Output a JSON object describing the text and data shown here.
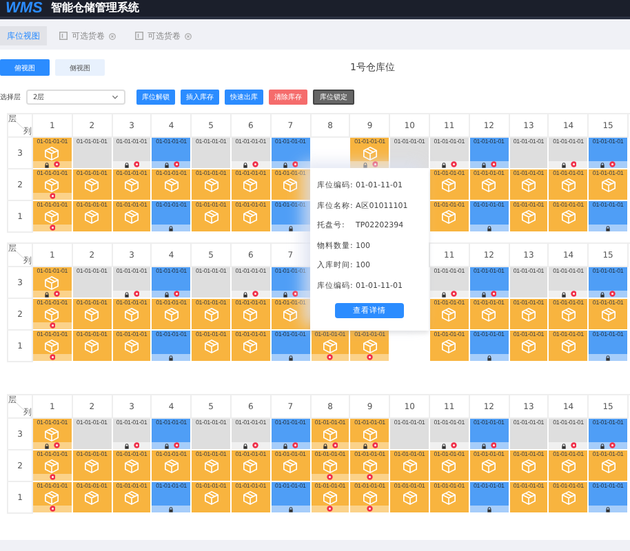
{
  "header": {
    "logo": "WMS",
    "title": "智能仓储管理系统"
  },
  "tabs": [
    {
      "label": "库位视图",
      "selected": true,
      "closable": false
    },
    {
      "label": "可选货卷",
      "selected": false,
      "closable": true
    },
    {
      "label": "可选货卷",
      "selected": false,
      "closable": true
    }
  ],
  "views": [
    {
      "label": "俯视图",
      "selected": true
    },
    {
      "label": "侧视图",
      "selected": false
    }
  ],
  "page_title": "1号仓库位",
  "layer_select": {
    "label": "选择层",
    "value": "2层"
  },
  "actions": [
    {
      "label": "库位解锁",
      "kind": "primary"
    },
    {
      "label": "插入库存",
      "kind": "primary"
    },
    {
      "label": "快速出库",
      "kind": "primary"
    },
    {
      "label": "清除库存",
      "kind": "danger"
    },
    {
      "label": "库位锁定",
      "kind": "dark"
    }
  ],
  "grids": [
    {
      "corner": {
        "top": "层",
        "bottom": "列"
      },
      "columns": [
        "1",
        "2",
        "3",
        "4",
        "5",
        "6",
        "7",
        "8",
        "9",
        "10",
        "11",
        "12",
        "13",
        "14",
        "15"
      ],
      "rows": [
        {
          "label": "3",
          "cells": [
            {
              "kind": "stocked",
              "code": "01-01-01-01",
              "locked": true,
              "alert": true
            },
            {
              "kind": "empty",
              "code": "01-01-01-01",
              "locked": false,
              "alert": false
            },
            {
              "kind": "empty",
              "code": "01-01-01-01",
              "locked": true,
              "alert": true
            },
            {
              "kind": "frozen",
              "code": "01-01-01-01",
              "locked": true,
              "alert": true
            },
            {
              "kind": "empty",
              "code": "01-01-01-01",
              "locked": false,
              "alert": false
            },
            {
              "kind": "empty",
              "code": "01-01-01-01",
              "locked": true,
              "alert": true
            },
            {
              "kind": "frozen",
              "code": "01-01-01-01",
              "locked": true,
              "alert": true
            },
            null,
            {
              "kind": "stocked",
              "code": "01-01-01-01",
              "locked": true,
              "alert": true
            },
            {
              "kind": "empty",
              "code": "01-01-01-01",
              "locked": false,
              "alert": false
            },
            {
              "kind": "empty",
              "code": "01-01-01-01",
              "locked": true,
              "alert": true
            },
            {
              "kind": "frozen",
              "code": "01-01-01-01",
              "locked": true,
              "alert": true
            },
            {
              "kind": "empty",
              "code": "01-01-01-01",
              "locked": false,
              "alert": false
            },
            {
              "kind": "empty",
              "code": "01-01-01-01",
              "locked": true,
              "alert": true
            },
            {
              "kind": "frozen",
              "code": "01-01-01-01",
              "locked": true,
              "alert": true
            }
          ]
        },
        {
          "label": "2",
          "cells": [
            {
              "kind": "stocked",
              "code": "01-01-01-01",
              "locked": false,
              "alert": true
            },
            {
              "kind": "stocked",
              "code": "01-01-01-01",
              "locked": false,
              "alert": false
            },
            {
              "kind": "stocked",
              "code": "01-01-01-01",
              "locked": false,
              "alert": false
            },
            {
              "kind": "stocked",
              "code": "01-01-01-01",
              "locked": false,
              "alert": false
            },
            {
              "kind": "stocked",
              "code": "01-01-01-01",
              "locked": false,
              "alert": false
            },
            {
              "kind": "stocked",
              "code": "01-01-01-01",
              "locked": false,
              "alert": false
            },
            {
              "kind": "stocked",
              "code": "01-01-01-01",
              "locked": false,
              "alert": false
            },
            null,
            null,
            null,
            {
              "kind": "stocked",
              "code": "01-01-01-01",
              "locked": false,
              "alert": false
            },
            {
              "kind": "stocked",
              "code": "01-01-01-01",
              "locked": false,
              "alert": false
            },
            {
              "kind": "stocked",
              "code": "01-01-01-01",
              "locked": false,
              "alert": false
            },
            {
              "kind": "stocked",
              "code": "01-01-01-01",
              "locked": false,
              "alert": false
            },
            {
              "kind": "stocked",
              "code": "01-01-01-01",
              "locked": false,
              "alert": false
            }
          ]
        },
        {
          "label": "1",
          "cells": [
            {
              "kind": "stocked",
              "code": "01-01-01-01",
              "locked": false,
              "alert": true
            },
            {
              "kind": "stocked",
              "code": "01-01-01-01",
              "locked": false,
              "alert": false
            },
            {
              "kind": "stocked",
              "code": "01-01-01-01",
              "locked": false,
              "alert": false
            },
            {
              "kind": "frozen",
              "code": "01-01-01-01",
              "locked": true,
              "alert": false
            },
            {
              "kind": "stocked",
              "code": "01-01-01-01",
              "locked": false,
              "alert": false
            },
            {
              "kind": "stocked",
              "code": "01-01-01-01",
              "locked": false,
              "alert": false
            },
            {
              "kind": "frozen",
              "code": "01-01-01-01",
              "locked": true,
              "alert": false
            },
            null,
            null,
            null,
            {
              "kind": "stocked",
              "code": "01-01-01-01",
              "locked": false,
              "alert": false
            },
            {
              "kind": "frozen",
              "code": "01-01-01-01",
              "locked": true,
              "alert": false
            },
            {
              "kind": "stocked",
              "code": "01-01-01-01",
              "locked": false,
              "alert": false
            },
            {
              "kind": "stocked",
              "code": "01-01-01-01",
              "locked": false,
              "alert": false
            },
            {
              "kind": "frozen",
              "code": "01-01-01-01",
              "locked": true,
              "alert": false
            }
          ]
        }
      ]
    },
    {
      "corner": {
        "top": "层",
        "bottom": "列"
      },
      "columns": [
        "1",
        "2",
        "3",
        "4",
        "5",
        "6",
        "7",
        null,
        null,
        null,
        "11",
        "12",
        "13",
        "14",
        "15"
      ],
      "rows": [
        {
          "label": "3",
          "cells": [
            {
              "kind": "stocked",
              "code": "01-01-01-01",
              "locked": true,
              "alert": true
            },
            {
              "kind": "empty",
              "code": "01-01-01-01",
              "locked": false,
              "alert": false
            },
            {
              "kind": "empty",
              "code": "01-01-01-01",
              "locked": true,
              "alert": true
            },
            {
              "kind": "frozen",
              "code": "01-01-01-01",
              "locked": true,
              "alert": true
            },
            {
              "kind": "empty",
              "code": "01-01-01-01",
              "locked": false,
              "alert": false
            },
            {
              "kind": "empty",
              "code": "01-01-01-01",
              "locked": true,
              "alert": true
            },
            {
              "kind": "frozen",
              "code": "01-01-01-01",
              "locked": true,
              "alert": true
            },
            null,
            null,
            null,
            {
              "kind": "empty",
              "code": "01-01-01-01",
              "locked": true,
              "alert": true
            },
            {
              "kind": "frozen",
              "code": "01-01-01-01",
              "locked": true,
              "alert": true
            },
            {
              "kind": "empty",
              "code": "01-01-01-01",
              "locked": false,
              "alert": false
            },
            {
              "kind": "empty",
              "code": "01-01-01-01",
              "locked": true,
              "alert": true
            },
            {
              "kind": "frozen",
              "code": "01-01-01-01",
              "locked": true,
              "alert": true
            }
          ]
        },
        {
          "label": "2",
          "cells": [
            {
              "kind": "stocked",
              "code": "01-01-01-01",
              "locked": false,
              "alert": true
            },
            {
              "kind": "stocked",
              "code": "01-01-01-01",
              "locked": false,
              "alert": false
            },
            {
              "kind": "stocked",
              "code": "01-01-01-01",
              "locked": false,
              "alert": false
            },
            {
              "kind": "stocked",
              "code": "01-01-01-01",
              "locked": false,
              "alert": false
            },
            {
              "kind": "stocked",
              "code": "01-01-01-01",
              "locked": false,
              "alert": false
            },
            {
              "kind": "stocked",
              "code": "01-01-01-01",
              "locked": false,
              "alert": false
            },
            {
              "kind": "stocked",
              "code": "01-01-01-01",
              "locked": false,
              "alert": false
            },
            null,
            null,
            null,
            {
              "kind": "stocked",
              "code": "01-01-01-01",
              "locked": false,
              "alert": false
            },
            {
              "kind": "stocked",
              "code": "01-01-01-01",
              "locked": false,
              "alert": false
            },
            {
              "kind": "stocked",
              "code": "01-01-01-01",
              "locked": false,
              "alert": false
            },
            {
              "kind": "stocked",
              "code": "01-01-01-01",
              "locked": false,
              "alert": false
            },
            {
              "kind": "stocked",
              "code": "01-01-01-01",
              "locked": false,
              "alert": false
            }
          ]
        },
        {
          "label": "1",
          "cells": [
            {
              "kind": "stocked",
              "code": "01-01-01-01",
              "locked": false,
              "alert": true
            },
            {
              "kind": "stocked",
              "code": "01-01-01-01",
              "locked": false,
              "alert": false
            },
            {
              "kind": "stocked",
              "code": "01-01-01-01",
              "locked": false,
              "alert": false
            },
            {
              "kind": "frozen",
              "code": "01-01-01-01",
              "locked": true,
              "alert": false
            },
            {
              "kind": "stocked",
              "code": "01-01-01-01",
              "locked": false,
              "alert": false
            },
            {
              "kind": "stocked",
              "code": "01-01-01-01",
              "locked": false,
              "alert": false
            },
            {
              "kind": "frozen",
              "code": "01-01-01-01",
              "locked": true,
              "alert": false
            },
            {
              "kind": "stocked",
              "code": "01-01-01-01",
              "locked": false,
              "alert": true
            },
            {
              "kind": "stocked",
              "code": "01-01-01-01",
              "locked": false,
              "alert": true
            },
            null,
            {
              "kind": "stocked",
              "code": "01-01-01-01",
              "locked": false,
              "alert": false
            },
            {
              "kind": "frozen",
              "code": "01-01-01-01",
              "locked": true,
              "alert": false
            },
            {
              "kind": "stocked",
              "code": "01-01-01-01",
              "locked": false,
              "alert": false
            },
            {
              "kind": "stocked",
              "code": "01-01-01-01",
              "locked": false,
              "alert": false
            },
            {
              "kind": "frozen",
              "code": "01-01-01-01",
              "locked": true,
              "alert": false
            }
          ]
        }
      ]
    },
    {
      "corner": {
        "top": "层",
        "bottom": "列"
      },
      "columns": [
        "1",
        "2",
        "3",
        "4",
        "5",
        "6",
        "7",
        "8",
        "9",
        "10",
        "11",
        "12",
        "13",
        "14",
        "15"
      ],
      "rows": [
        {
          "label": "3",
          "cells": [
            {
              "kind": "stocked",
              "code": "01-01-01-01",
              "locked": true,
              "alert": true
            },
            {
              "kind": "empty",
              "code": "01-01-01-01",
              "locked": false,
              "alert": false
            },
            {
              "kind": "empty",
              "code": "01-01-01-01",
              "locked": true,
              "alert": true
            },
            {
              "kind": "frozen",
              "code": "01-01-01-01",
              "locked": true,
              "alert": true
            },
            {
              "kind": "empty",
              "code": "01-01-01-01",
              "locked": false,
              "alert": false
            },
            {
              "kind": "empty",
              "code": "01-01-01-01",
              "locked": true,
              "alert": true
            },
            {
              "kind": "frozen",
              "code": "01-01-01-01",
              "locked": true,
              "alert": true
            },
            {
              "kind": "stocked",
              "code": "01-01-01-01",
              "locked": true,
              "alert": true
            },
            {
              "kind": "stocked",
              "code": "01-01-01-01",
              "locked": true,
              "alert": true
            },
            {
              "kind": "empty",
              "code": "01-01-01-01",
              "locked": false,
              "alert": false
            },
            {
              "kind": "empty",
              "code": "01-01-01-01",
              "locked": true,
              "alert": true
            },
            {
              "kind": "frozen",
              "code": "01-01-01-01",
              "locked": true,
              "alert": true
            },
            {
              "kind": "empty",
              "code": "01-01-01-01",
              "locked": false,
              "alert": false
            },
            {
              "kind": "empty",
              "code": "01-01-01-01",
              "locked": true,
              "alert": true
            },
            {
              "kind": "frozen",
              "code": "01-01-01-01",
              "locked": true,
              "alert": true
            }
          ]
        },
        {
          "label": "2",
          "cells": [
            {
              "kind": "stocked",
              "code": "01-01-01-01",
              "locked": false,
              "alert": true
            },
            {
              "kind": "stocked",
              "code": "01-01-01-01",
              "locked": false,
              "alert": false
            },
            {
              "kind": "stocked",
              "code": "01-01-01-01",
              "locked": false,
              "alert": false
            },
            {
              "kind": "stocked",
              "code": "01-01-01-01",
              "locked": false,
              "alert": false
            },
            {
              "kind": "stocked",
              "code": "01-01-01-01",
              "locked": false,
              "alert": false
            },
            {
              "kind": "stocked",
              "code": "01-01-01-01",
              "locked": false,
              "alert": false
            },
            {
              "kind": "stocked",
              "code": "01-01-01-01",
              "locked": false,
              "alert": false
            },
            {
              "kind": "stocked",
              "code": "01-01-01-01",
              "locked": false,
              "alert": true
            },
            {
              "kind": "stocked",
              "code": "01-01-01-01",
              "locked": false,
              "alert": true
            },
            {
              "kind": "stocked",
              "code": "01-01-01-01",
              "locked": false,
              "alert": false
            },
            {
              "kind": "stocked",
              "code": "01-01-01-01",
              "locked": false,
              "alert": false
            },
            {
              "kind": "stocked",
              "code": "01-01-01-01",
              "locked": false,
              "alert": false
            },
            {
              "kind": "stocked",
              "code": "01-01-01-01",
              "locked": false,
              "alert": false
            },
            {
              "kind": "stocked",
              "code": "01-01-01-01",
              "locked": false,
              "alert": false
            },
            {
              "kind": "stocked",
              "code": "01-01-01-01",
              "locked": false,
              "alert": false
            }
          ]
        },
        {
          "label": "1",
          "cells": [
            {
              "kind": "stocked",
              "code": "01-01-01-01",
              "locked": false,
              "alert": true
            },
            {
              "kind": "stocked",
              "code": "01-01-01-01",
              "locked": false,
              "alert": false
            },
            {
              "kind": "stocked",
              "code": "01-01-01-01",
              "locked": false,
              "alert": false
            },
            {
              "kind": "frozen",
              "code": "01-01-01-01",
              "locked": true,
              "alert": false
            },
            {
              "kind": "stocked",
              "code": "01-01-01-01",
              "locked": false,
              "alert": false
            },
            {
              "kind": "stocked",
              "code": "01-01-01-01",
              "locked": false,
              "alert": false
            },
            {
              "kind": "frozen",
              "code": "01-01-01-01",
              "locked": true,
              "alert": false
            },
            {
              "kind": "stocked",
              "code": "01-01-01-01",
              "locked": false,
              "alert": true
            },
            {
              "kind": "stocked",
              "code": "01-01-01-01",
              "locked": false,
              "alert": true
            },
            {
              "kind": "stocked",
              "code": "01-01-01-01",
              "locked": false,
              "alert": false
            },
            {
              "kind": "stocked",
              "code": "01-01-01-01",
              "locked": false,
              "alert": false
            },
            {
              "kind": "frozen",
              "code": "01-01-01-01",
              "locked": true,
              "alert": false
            },
            {
              "kind": "stocked",
              "code": "01-01-01-01",
              "locked": false,
              "alert": false
            },
            {
              "kind": "stocked",
              "code": "01-01-01-01",
              "locked": false,
              "alert": false
            },
            {
              "kind": "frozen",
              "code": "01-01-01-01",
              "locked": true,
              "alert": false
            }
          ]
        }
      ]
    }
  ],
  "popup": {
    "fields": [
      {
        "label": "库位编码:",
        "value": "01-01-11-01"
      },
      {
        "label": "库位名称:",
        "value": "A区01011101"
      },
      {
        "label": "托盘号:",
        "value": "TP02202394"
      },
      {
        "label": "物料数量:",
        "value": "100"
      },
      {
        "label": "入库时间:",
        "value": "100"
      },
      {
        "label": "库位编码:",
        "value": "01-01-11-01"
      }
    ],
    "button": "查看详情"
  }
}
